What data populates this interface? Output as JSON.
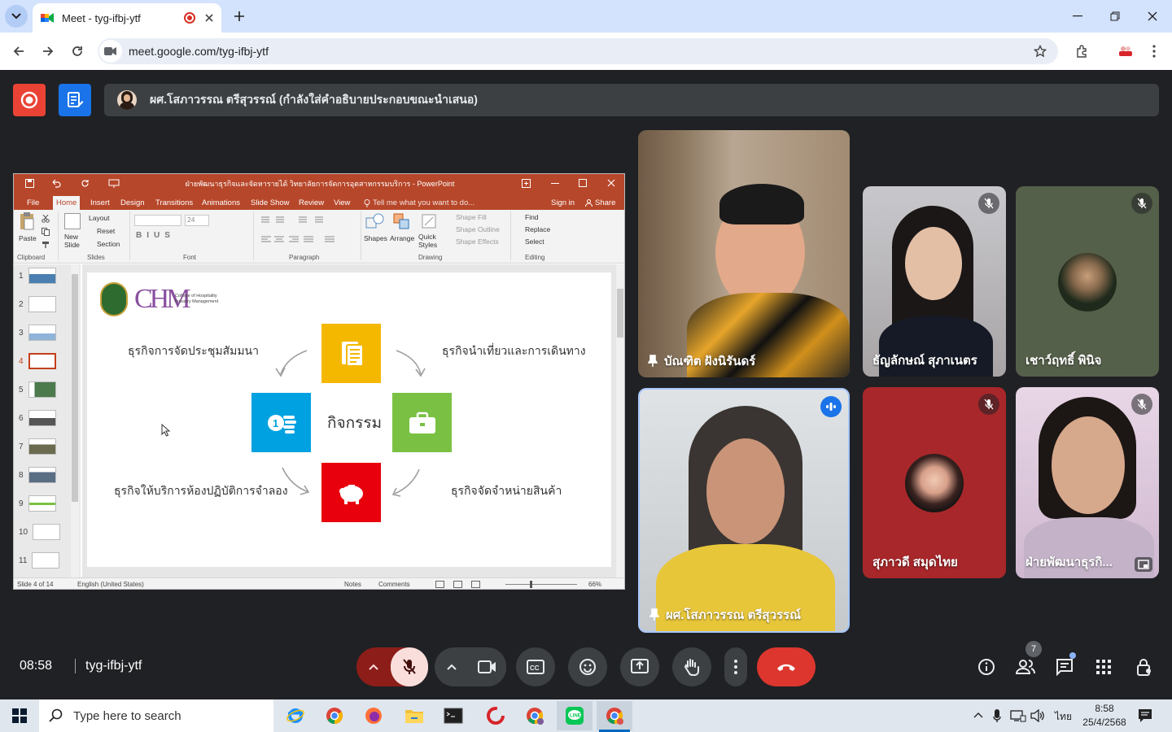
{
  "browser": {
    "tab_title": "Meet - tyg-ifbj-ytf",
    "url": "meet.google.com/tyg-ifbj-ytf"
  },
  "meet": {
    "presenter_caption": "ผศ.โสภาวรรณ ตรีสุวรรณ์ (กำลังใส่คำอธิบายประกอบขณะนำเสนอ)",
    "meeting_time": "08:58",
    "meeting_code": "tyg-ifbj-ytf",
    "participant_count": "7",
    "participants": [
      {
        "name": "บัณฑิต ฝังนิรันดร์",
        "pinned": true
      },
      {
        "name": "ธัญลักษณ์ สุภาเนตร",
        "muted": true
      },
      {
        "name": "เชาว์ฤทธิ์ พินิจ",
        "muted": true
      },
      {
        "name": "ผศ.โสภาวรรณ ตรีสุวรรณ์",
        "pinned": true,
        "speaking": true
      },
      {
        "name": "สุภาวดี สมุดไทย",
        "muted": true
      },
      {
        "name": "ฝ่ายพัฒนาธุรกิ...",
        "muted": true
      }
    ]
  },
  "powerpoint": {
    "title": "ฝ่ายพัฒนาธุรกิจและจัดหารายได้ วิทยาลัยการจัดการอุตสาหกรรมบริการ - PowerPoint",
    "tabs": [
      "File",
      "Home",
      "Insert",
      "Design",
      "Transitions",
      "Animations",
      "Slide Show",
      "Review",
      "View"
    ],
    "tell_me": "Tell me what you want to do...",
    "sign_in": "Sign in",
    "share": "Share",
    "ribbon": {
      "paste": "Paste",
      "new_slide": "New Slide",
      "layout": "Layout",
      "reset": "Reset",
      "section": "Section",
      "font_size": "24",
      "shapes": "Shapes",
      "arrange": "Arrange",
      "quick_styles": "Quick Styles",
      "shape_fill": "Shape Fill",
      "shape_outline": "Shape Outline",
      "shape_effects": "Shape Effects",
      "find": "Find",
      "replace": "Replace",
      "select": "Select",
      "groups": [
        "Clipboard",
        "Slides",
        "Font",
        "Paragraph",
        "Drawing",
        "Editing"
      ]
    },
    "thumb_numbers": [
      "1",
      "2",
      "3",
      "4",
      "5",
      "6",
      "7",
      "8",
      "9",
      "10",
      "11"
    ],
    "status": {
      "slide": "Slide 4 of 14",
      "language": "English (United States)",
      "notes": "Notes",
      "comments": "Comments",
      "zoom": "66%"
    },
    "slide": {
      "logo_text_1": "College of Hospitality",
      "logo_text_2": "Industry Management",
      "logo_letters": "CHM",
      "center": "กิจกรรม",
      "top_left": "ธุรกิจการจัดประชุมสัมมนา",
      "top_right": "ธุรกิจนำเที่ยวและการเดินทาง",
      "bottom_left": "ธุรกิจให้บริการห้องปฏิบัติการจำลอง",
      "bottom_right": "ธุรกิจจัดจำหน่ายสินค้า",
      "colors": {
        "yellow": "#f5b800",
        "green": "#7ac143",
        "red": "#e8000d",
        "blue": "#00a1e0"
      }
    }
  },
  "taskbar": {
    "search_placeholder": "Type here to search",
    "time": "8:58",
    "date": "25/4/2568",
    "lang": "ไทย"
  }
}
